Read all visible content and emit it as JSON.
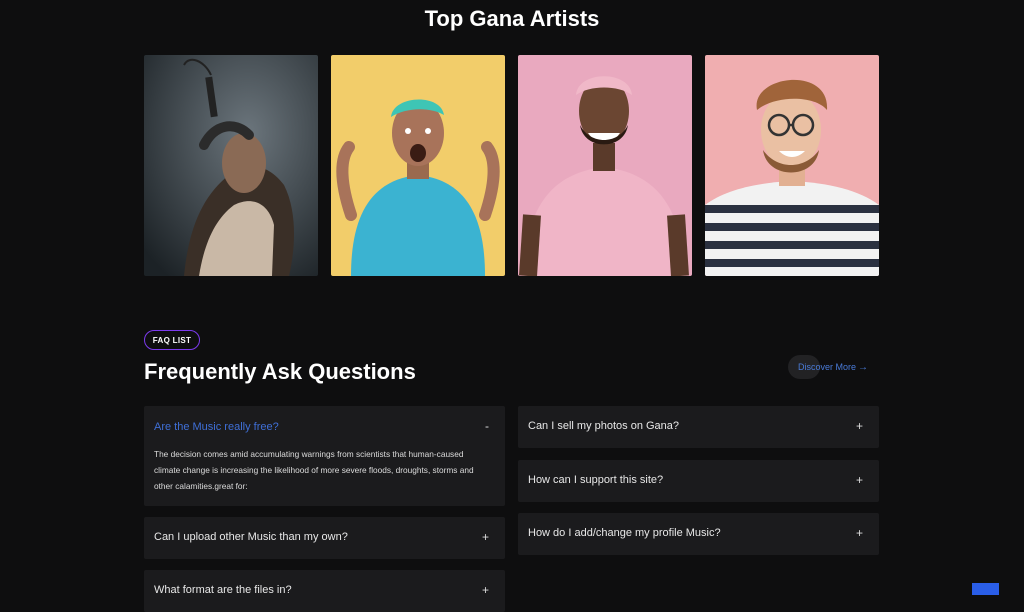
{
  "artists_section": {
    "title": "Top Gana Artists",
    "cards": [
      {
        "icon": "artist-photo-singer"
      },
      {
        "icon": "artist-photo-excited"
      },
      {
        "icon": "artist-photo-smiling"
      },
      {
        "icon": "artist-photo-glasses"
      }
    ]
  },
  "faq_section": {
    "badge": "FAQ LIST",
    "heading": "Frequently Ask Questions",
    "discover_label": "Discover More",
    "discover_arrow": "→",
    "left_column": [
      {
        "question": "Are the Music really free?",
        "toggle": "-",
        "expanded": true,
        "answer": "The decision comes amid accumulating warnings from scientists that human-caused climate change is increasing the likelihood of more severe floods, droughts, storms and other calamities.great for:"
      },
      {
        "question": "Can I upload other Music than my own?",
        "toggle": "+"
      },
      {
        "question": "What format are the files in?",
        "toggle": "+"
      }
    ],
    "right_column": [
      {
        "question": "Can I sell my photos on Gana?",
        "toggle": "+"
      },
      {
        "question": "How can I support this site?",
        "toggle": "+"
      },
      {
        "question": "How do I add/change my profile Music?",
        "toggle": "+"
      }
    ]
  },
  "colors": {
    "background": "#0e0e0f",
    "card": "#1b1b1d",
    "accent_blue": "#3f6fd6",
    "badge_border": "#7c3aed"
  }
}
